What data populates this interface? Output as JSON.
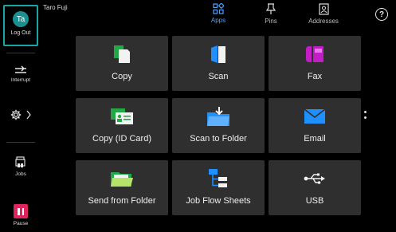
{
  "user": {
    "initials": "Ta",
    "name": "Taro Fuji",
    "logout_label": "Log Out"
  },
  "rail": {
    "interrupt_label": "Interrupt",
    "jobs_label": "Jobs",
    "pause_label": "Pause"
  },
  "nav": {
    "tabs": [
      {
        "label": "Apps",
        "icon": "apps-grid-icon",
        "active": true
      },
      {
        "label": "Pins",
        "icon": "pin-icon",
        "active": false
      },
      {
        "label": "Addresses",
        "icon": "address-book-icon",
        "active": false
      }
    ],
    "help_glyph": "?"
  },
  "apps": [
    {
      "label": "Copy",
      "icon": "copy-icon"
    },
    {
      "label": "Scan",
      "icon": "scan-icon"
    },
    {
      "label": "Fax",
      "icon": "fax-icon"
    },
    {
      "label": "Copy (ID Card)",
      "icon": "id-card-icon"
    },
    {
      "label": "Scan to Folder",
      "icon": "scan-to-folder-icon"
    },
    {
      "label": "Email",
      "icon": "email-icon"
    },
    {
      "label": "Send from Folder",
      "icon": "folder-icon"
    },
    {
      "label": "Job Flow Sheets",
      "icon": "job-flow-icon"
    },
    {
      "label": "USB",
      "icon": "usb-icon"
    }
  ],
  "colors": {
    "accent": "#1aa5a5",
    "active_tab": "#4da3ff",
    "pause": "#e0245e",
    "tile": "#2f2f2f"
  }
}
